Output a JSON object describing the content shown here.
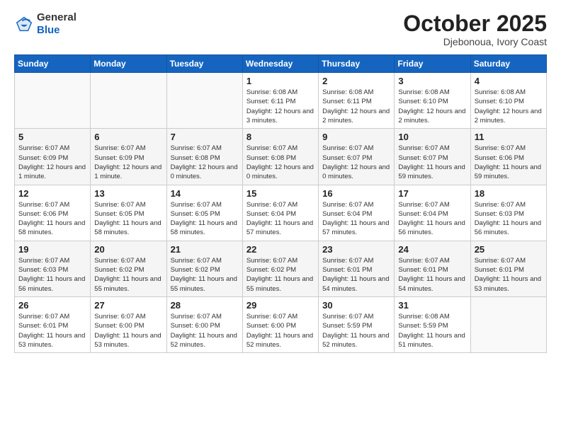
{
  "logo": {
    "general": "General",
    "blue": "Blue"
  },
  "header": {
    "title": "October 2025",
    "subtitle": "Djebonoua, Ivory Coast"
  },
  "weekdays": [
    "Sunday",
    "Monday",
    "Tuesday",
    "Wednesday",
    "Thursday",
    "Friday",
    "Saturday"
  ],
  "weeks": [
    [
      {
        "day": "",
        "info": ""
      },
      {
        "day": "",
        "info": ""
      },
      {
        "day": "",
        "info": ""
      },
      {
        "day": "1",
        "info": "Sunrise: 6:08 AM\nSunset: 6:11 PM\nDaylight: 12 hours and 3 minutes."
      },
      {
        "day": "2",
        "info": "Sunrise: 6:08 AM\nSunset: 6:11 PM\nDaylight: 12 hours and 2 minutes."
      },
      {
        "day": "3",
        "info": "Sunrise: 6:08 AM\nSunset: 6:10 PM\nDaylight: 12 hours and 2 minutes."
      },
      {
        "day": "4",
        "info": "Sunrise: 6:08 AM\nSunset: 6:10 PM\nDaylight: 12 hours and 2 minutes."
      }
    ],
    [
      {
        "day": "5",
        "info": "Sunrise: 6:07 AM\nSunset: 6:09 PM\nDaylight: 12 hours and 1 minute."
      },
      {
        "day": "6",
        "info": "Sunrise: 6:07 AM\nSunset: 6:09 PM\nDaylight: 12 hours and 1 minute."
      },
      {
        "day": "7",
        "info": "Sunrise: 6:07 AM\nSunset: 6:08 PM\nDaylight: 12 hours and 0 minutes."
      },
      {
        "day": "8",
        "info": "Sunrise: 6:07 AM\nSunset: 6:08 PM\nDaylight: 12 hours and 0 minutes."
      },
      {
        "day": "9",
        "info": "Sunrise: 6:07 AM\nSunset: 6:07 PM\nDaylight: 12 hours and 0 minutes."
      },
      {
        "day": "10",
        "info": "Sunrise: 6:07 AM\nSunset: 6:07 PM\nDaylight: 11 hours and 59 minutes."
      },
      {
        "day": "11",
        "info": "Sunrise: 6:07 AM\nSunset: 6:06 PM\nDaylight: 11 hours and 59 minutes."
      }
    ],
    [
      {
        "day": "12",
        "info": "Sunrise: 6:07 AM\nSunset: 6:06 PM\nDaylight: 11 hours and 58 minutes."
      },
      {
        "day": "13",
        "info": "Sunrise: 6:07 AM\nSunset: 6:05 PM\nDaylight: 11 hours and 58 minutes."
      },
      {
        "day": "14",
        "info": "Sunrise: 6:07 AM\nSunset: 6:05 PM\nDaylight: 11 hours and 58 minutes."
      },
      {
        "day": "15",
        "info": "Sunrise: 6:07 AM\nSunset: 6:04 PM\nDaylight: 11 hours and 57 minutes."
      },
      {
        "day": "16",
        "info": "Sunrise: 6:07 AM\nSunset: 6:04 PM\nDaylight: 11 hours and 57 minutes."
      },
      {
        "day": "17",
        "info": "Sunrise: 6:07 AM\nSunset: 6:04 PM\nDaylight: 11 hours and 56 minutes."
      },
      {
        "day": "18",
        "info": "Sunrise: 6:07 AM\nSunset: 6:03 PM\nDaylight: 11 hours and 56 minutes."
      }
    ],
    [
      {
        "day": "19",
        "info": "Sunrise: 6:07 AM\nSunset: 6:03 PM\nDaylight: 11 hours and 56 minutes."
      },
      {
        "day": "20",
        "info": "Sunrise: 6:07 AM\nSunset: 6:02 PM\nDaylight: 11 hours and 55 minutes."
      },
      {
        "day": "21",
        "info": "Sunrise: 6:07 AM\nSunset: 6:02 PM\nDaylight: 11 hours and 55 minutes."
      },
      {
        "day": "22",
        "info": "Sunrise: 6:07 AM\nSunset: 6:02 PM\nDaylight: 11 hours and 55 minutes."
      },
      {
        "day": "23",
        "info": "Sunrise: 6:07 AM\nSunset: 6:01 PM\nDaylight: 11 hours and 54 minutes."
      },
      {
        "day": "24",
        "info": "Sunrise: 6:07 AM\nSunset: 6:01 PM\nDaylight: 11 hours and 54 minutes."
      },
      {
        "day": "25",
        "info": "Sunrise: 6:07 AM\nSunset: 6:01 PM\nDaylight: 11 hours and 53 minutes."
      }
    ],
    [
      {
        "day": "26",
        "info": "Sunrise: 6:07 AM\nSunset: 6:01 PM\nDaylight: 11 hours and 53 minutes."
      },
      {
        "day": "27",
        "info": "Sunrise: 6:07 AM\nSunset: 6:00 PM\nDaylight: 11 hours and 53 minutes."
      },
      {
        "day": "28",
        "info": "Sunrise: 6:07 AM\nSunset: 6:00 PM\nDaylight: 11 hours and 52 minutes."
      },
      {
        "day": "29",
        "info": "Sunrise: 6:07 AM\nSunset: 6:00 PM\nDaylight: 11 hours and 52 minutes."
      },
      {
        "day": "30",
        "info": "Sunrise: 6:07 AM\nSunset: 5:59 PM\nDaylight: 11 hours and 52 minutes."
      },
      {
        "day": "31",
        "info": "Sunrise: 6:08 AM\nSunset: 5:59 PM\nDaylight: 11 hours and 51 minutes."
      },
      {
        "day": "",
        "info": ""
      }
    ]
  ]
}
